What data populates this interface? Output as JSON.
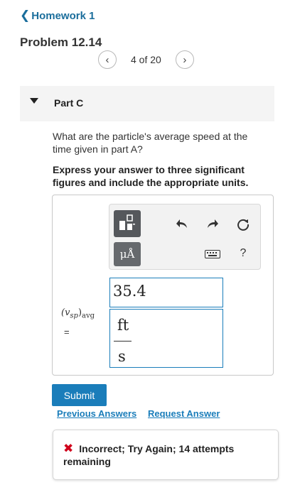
{
  "nav": {
    "back_label": "Homework 1"
  },
  "problem": {
    "title": "Problem 12.14"
  },
  "pager": {
    "text": "4 of 20"
  },
  "part": {
    "label": "Part C"
  },
  "question": {
    "text": "What are the particle's average speed at the time given in part A?",
    "instructions": "Express your answer to three significant figures and include the appropriate units."
  },
  "toolbar": {
    "units_label": "μÅ",
    "help_label": "?"
  },
  "answer": {
    "variable_label": "(vsp)avg",
    "variable_main": "(v",
    "variable_sub": "sp",
    "variable_close": ")",
    "variable_sub2": "avg",
    "equals": "=",
    "value": "35.4",
    "unit_numerator": "ft",
    "unit_denominator": "s"
  },
  "actions": {
    "submit_label": "Submit",
    "previous_answers": "Previous Answers",
    "request_answer": "Request Answer"
  },
  "feedback": {
    "text": "Incorrect; Try Again; 14 attempts remaining",
    "status_color": "#d0021b"
  },
  "colors": {
    "accent": "#1a7dba",
    "link": "#1b6e9c"
  }
}
